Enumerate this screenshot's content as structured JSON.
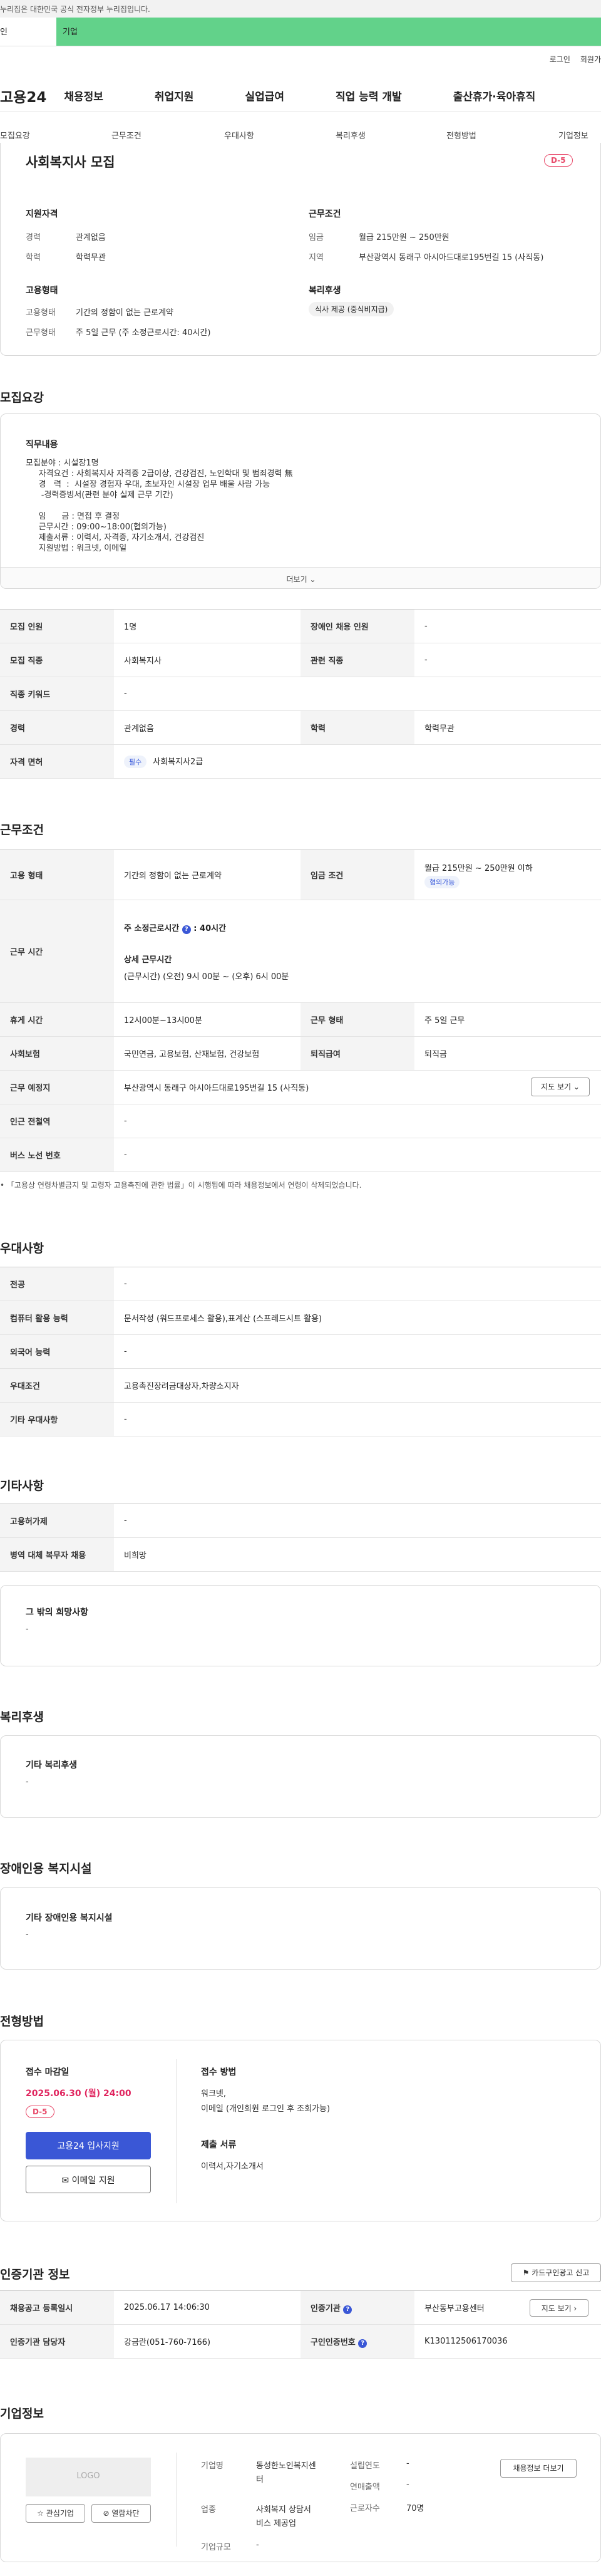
{
  "gov_bar": "누리집은 대한민국 공식 전자정부 누리집입니다.",
  "user_tabs": [
    "인",
    "기업"
  ],
  "top_links": [
    "로그인",
    "회원가"
  ],
  "gnb": {
    "logo": "고용24",
    "menu": [
      "채용정보",
      "취업지원",
      "실업급여",
      "직업 능력 개발",
      "출산휴가·육아휴직"
    ]
  },
  "snb": [
    "모집요강",
    "근무조건",
    "우대사항",
    "복리후생",
    "전형방법",
    "기업정보"
  ],
  "summary": {
    "title": "사회복지사 모집",
    "dday": "D-5",
    "qual_title": "지원자격",
    "career_l": "경력",
    "career_v": "관계없음",
    "edu_l": "학력",
    "edu_v": "학력무관",
    "work_title": "근무조건",
    "wage_l": "임금",
    "wage_v": "월급 215만원 ~ 250만원",
    "loc_l": "지역",
    "loc_v": "부산광역시 동래구 아시아드대로195번길 15 (사직동)",
    "emp_title": "고용형태",
    "emptype_l": "고용형태",
    "emptype_v": "기간의 정함이 없는 근로계약",
    "worktype_l": "근무형태",
    "worktype_v": "주 5일 근무 (주 소정근로시간: 40시간)",
    "welfare_title": "복리후생",
    "welfare_tag": "식사 제공 (중식비지급)"
  },
  "recruit": {
    "section": "모집요강",
    "job_title": "직무내용",
    "lines": [
      "모집분야 : 시설장1명",
      "     자격요건 : 사회복지사 자격증 2급이상, 건강검진, 노인학대 및 범죄경력 無",
      "     경   력  :  시설장 경험자 우대, 초보자인 시설장 업무 배울 사람 가능",
      "      -경력증빙서(관련 분야 실제 근무 기간)",
      "",
      "     임      금 : 면접 후 결정",
      "     근무시간 : 09:00~18:00(협의가능)",
      "     제출서류 : 이력서, 자격증, 자기소개서, 건강검진",
      "     지원방법 : 워크넷, 이메일"
    ],
    "more": "더보기",
    "rows": [
      [
        "모집 인원",
        "1명",
        "장애인 채용 인원",
        "-"
      ],
      [
        "모집 직종",
        "사회복지사",
        "관련 직종",
        "-"
      ],
      [
        "직종 키워드",
        "-"
      ],
      [
        "경력",
        "관계없음",
        "학력",
        "학력무관"
      ],
      [
        "자격 면허",
        "필수",
        "사회복지사2급"
      ]
    ]
  },
  "conditions": {
    "section": "근무조건",
    "emptype_h": "고용 형태",
    "emptype_v": "기간의 정함이 없는 근로계약",
    "wage_h": "임금 조건",
    "wage_v": "월급 215만원 ~ 250만원 이하",
    "wage_tag": "협의가능",
    "hours_h": "근무 시간",
    "weekly": "주 소정근로시간",
    "weekly_v": "40시간",
    "detail_t": "상세 근무시간",
    "detail_v": "(근무시간) (오전) 9시 00분 ~ (오후) 6시 00분",
    "rest_h": "휴게 시간",
    "rest_v": "12시00분~13시00분",
    "form_h": "근무 형태",
    "form_v": "주 5일 근무",
    "ins_h": "사회보험",
    "ins_v": "국민연금, 고용보험, 산재보험, 건강보험",
    "sev_h": "퇴직급여",
    "sev_v": "퇴직금",
    "place_h": "근무 예정지",
    "place_v": "부산광역시 동래구 아시아드대로195번길 15 (사직동)",
    "map_btn": "지도 보기",
    "sub_h": "인근 전철역",
    "sub_v": "-",
    "bus_h": "버스 노선 번호",
    "bus_v": "-",
    "note": "「고용상 연령차별금지 및 고령자 고용촉진에 관한 법률」이 시행됨에 따라 채용정보에서 연령이 삭제되었습니다."
  },
  "prefer": {
    "section": "우대사항",
    "rows": [
      [
        "전공",
        "-"
      ],
      [
        "컴퓨터 활용 능력",
        "문서작성 (워드프로세스 활용),표계산 (스프레드시트 활용)"
      ],
      [
        "외국어 능력",
        "-"
      ],
      [
        "우대조건",
        "고용촉진장려금대상자,차량소지자"
      ],
      [
        "기타 우대사항",
        "-"
      ]
    ]
  },
  "etc": {
    "section": "기타사항",
    "rows": [
      [
        "고용허가제",
        "-"
      ],
      [
        "병역 대체 복무자 채용",
        "비희망"
      ]
    ],
    "other_t": "그 밖의 희망사항",
    "other_v": "-"
  },
  "benefit": {
    "section": "복리후생",
    "t": "기타 복리후생",
    "v": "-"
  },
  "facility": {
    "section": "장애인용 복지시설",
    "t": "기타 장애인용 복지시설",
    "v": "-"
  },
  "process": {
    "section": "전형방법",
    "deadline_t": "접수 마감일",
    "deadline_v": "2025.06.30 (월) 24:00",
    "dday": "D-5",
    "apply_btn": "고용24 입사지원",
    "email_btn": "이메일 지원",
    "method_t": "접수 방법",
    "method_v1": "워크넷,",
    "method_v2": "이메일 (개인회원 로그인 후 조회가능)",
    "docs_t": "제출 서류",
    "docs_v": "이력서,자기소개서"
  },
  "cert": {
    "section": "인증기관 정보",
    "card_btn": "카드구인광고 신고",
    "reg_h": "채용공고 등록일시",
    "reg_v": "2025.06.17 14:06:30",
    "org_h": "인증기관",
    "org_v": "부산동부고용센터",
    "map_btn": "지도 보기",
    "mgr_h": "인증기관 담당자",
    "mgr_v": "강금란(051-760-7166)",
    "num_h": "구인인증번호",
    "num_v": "K130112506170036"
  },
  "company": {
    "section": "기업정보",
    "logo": "LOGO",
    "fav_btn": "관심기업",
    "block_btn": "열람차단",
    "jobs_btn": "채용정보 더보기",
    "name_l": "기업명",
    "name_v1": "동성한노인복지센",
    "name_v2": "터",
    "year_l": "설립연도",
    "year_v": "-",
    "sales_l": "연매출액",
    "sales_v": "-",
    "ind_l": "업종",
    "ind_v1": "사회복지 상담서",
    "ind_v2": "비스 제공업",
    "emp_l": "근로자수",
    "emp_v": "70명",
    "size_l": "기업규모",
    "size_v": "-"
  },
  "colors": {
    "accent": "#62d28a",
    "primary": "#3a57d6",
    "deadline": "#e0245e"
  }
}
